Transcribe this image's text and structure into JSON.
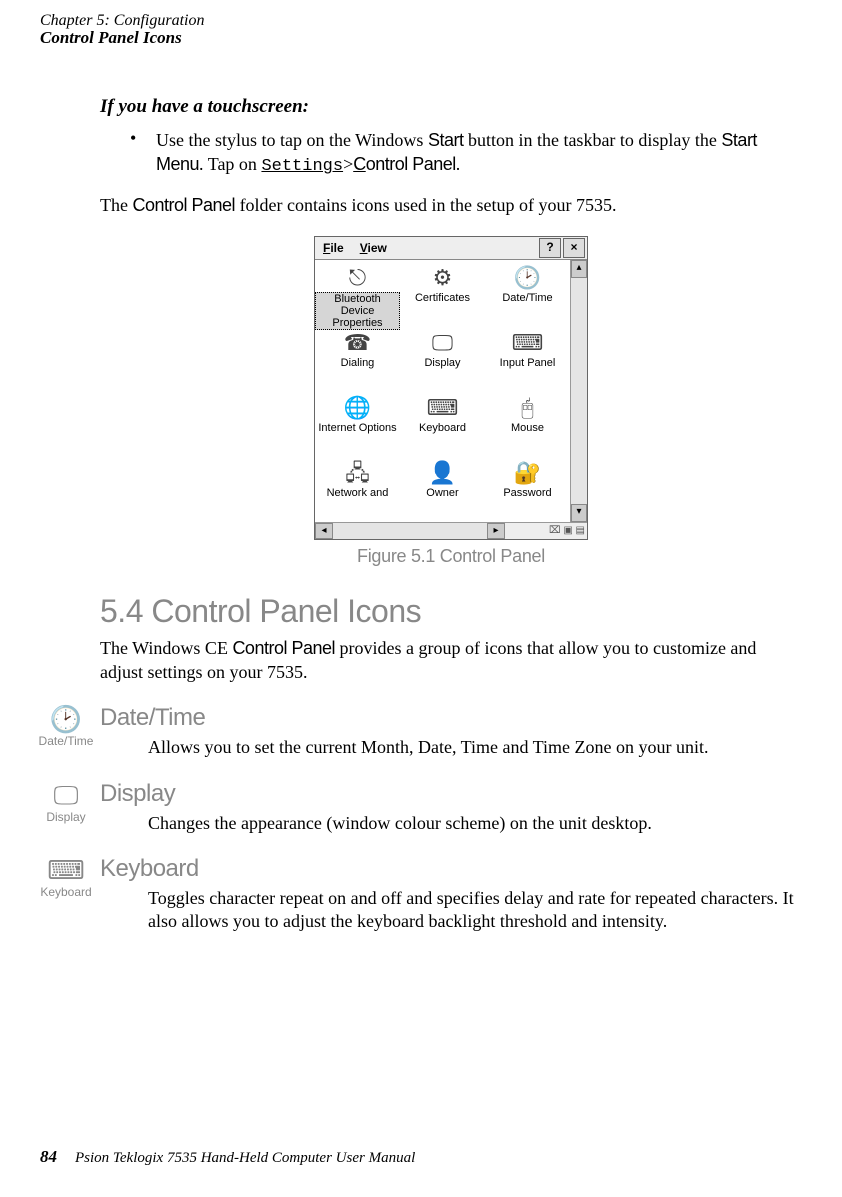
{
  "header": {
    "chapter": "Chapter 5: Configuration",
    "section_title": "Control Panel Icons"
  },
  "touchscreen": {
    "heading": "If you have a touchscreen:",
    "bullet_pre": "Use the stylus to tap on the Windows ",
    "bullet_start": "Start",
    "bullet_mid": " button in the taskbar to display the ",
    "bullet_startmenu": "Start Menu",
    "bullet_tapon": ". Tap on ",
    "bullet_settings": "Settings",
    "bullet_gt": ">",
    "bullet_cp_u": "C",
    "bullet_cp_rest": "ontrol Panel",
    "bullet_end": "."
  },
  "folder_line_pre": "The ",
  "folder_line_cp": "Control Panel",
  "folder_line_post": " folder contains icons used in the setup of your 7535.",
  "cp_window": {
    "menu_file_u": "F",
    "menu_file_rest": "ile",
    "menu_view_u": "V",
    "menu_view_rest": "iew",
    "help_btn": "?",
    "close_btn": "×",
    "items": [
      {
        "label": "Bluetooth Device Properties",
        "selected": true
      },
      {
        "label": "Certificates"
      },
      {
        "label": "Date/Time"
      },
      {
        "label": "Dialing"
      },
      {
        "label": "Display"
      },
      {
        "label": "Input Panel"
      },
      {
        "label": "Internet Options"
      },
      {
        "label": "Keyboard"
      },
      {
        "label": "Mouse"
      },
      {
        "label": "Network and"
      },
      {
        "label": "Owner"
      },
      {
        "label": "Password"
      }
    ],
    "arrow_up": "▴",
    "arrow_down": "▾",
    "arrow_left": "◂",
    "arrow_right": "▸"
  },
  "figure_caption": "Figure 5.1 Control Panel",
  "h2": "5.4  Control Panel Icons",
  "h2_body_pre": "The Windows CE ",
  "h2_body_cp": "Control Panel",
  "h2_body_post": " provides a group of icons that allow you to customize and adjust settings on your 7535.",
  "sections": {
    "datetime": {
      "icon_label": "Date/Time",
      "heading": "Date/Time",
      "body": "Allows you to set the current Month, Date, Time and Time Zone on your unit."
    },
    "display": {
      "icon_label": "Display",
      "heading": "Display",
      "body": "Changes the appearance (window colour scheme) on the unit desktop."
    },
    "keyboard": {
      "icon_label": "Keyboard",
      "heading": "Keyboard",
      "body": "Toggles character repeat on and off and specifies delay and rate for repeated characters. It also allows you to adjust the keyboard backlight threshold and intensity."
    }
  },
  "footer": {
    "page_number": "84",
    "manual": "Psion Teklogix 7535 Hand-Held Computer User Manual"
  }
}
